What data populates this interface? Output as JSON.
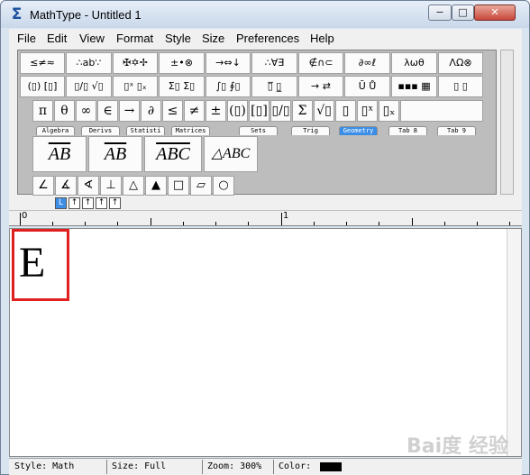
{
  "window": {
    "title": "MathType - Untitled 1",
    "min_label": "−",
    "max_label": "□",
    "close_label": "✕"
  },
  "menu": [
    "File",
    "Edit",
    "View",
    "Format",
    "Style",
    "Size",
    "Preferences",
    "Help"
  ],
  "palette": {
    "row1": [
      "≤≠≈",
      "∴ab∵",
      "✠✡✢",
      "±•⊗",
      "→⇔↓",
      "∴∀∃",
      "∉∩⊂",
      "∂∞ℓ",
      "λωθ",
      "ΛΩ⊗"
    ],
    "row2": [
      "(▯) [▯]",
      "▯/▯ √▯",
      "▯ˣ ▯ₓ",
      "Σ▯ Σ▯",
      "∫▯ ∮▯",
      "▯̅ ▯̲",
      "→ ⇄",
      "Ū Ů",
      "▪▪▪ ▦",
      "▯ ▯"
    ],
    "row3": [
      "π",
      "θ",
      "∞",
      "∈",
      "→",
      "∂",
      "≤",
      "≠",
      "±",
      "(▯)",
      "[▯]",
      "▯/▯",
      "Σ",
      "√▯",
      "▯",
      "▯ˣ",
      "▯ₓ"
    ],
    "tabs": [
      "Algebra",
      "Derivs",
      "Statisti",
      "Matrices",
      "Sets",
      "Trig",
      "Geometry",
      "Tab 8",
      "Tab 9"
    ],
    "active_tab": "Geometry",
    "templates": [
      "AB",
      "AB",
      "ABC",
      "△ABC"
    ],
    "geometry": [
      "∠",
      "∡",
      "∢",
      "⊥",
      "△",
      "▲",
      "□",
      "▱",
      "○"
    ]
  },
  "size_buttons": [
    "L",
    "↑",
    "↑",
    "↑",
    "↑"
  ],
  "ruler": {
    "marks": [
      "0",
      "1"
    ]
  },
  "document": {
    "content": "E"
  },
  "status": {
    "style": "Style: Math",
    "size": "Size: Full",
    "zoom": "Zoom: 300%",
    "color": "Color:"
  },
  "watermark": "Bai度 经验"
}
